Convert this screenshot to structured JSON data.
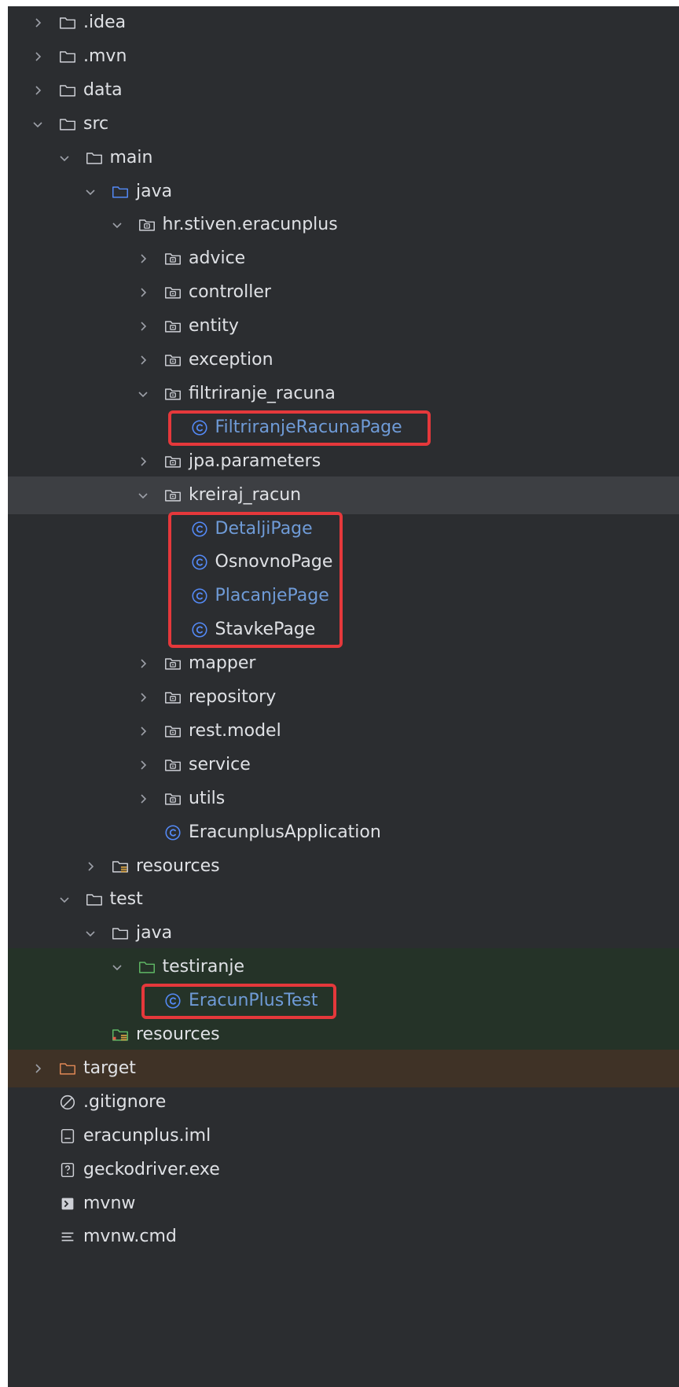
{
  "tree": [
    {
      "label": ".idea",
      "icon": "folder",
      "expand": "collapsed",
      "depth": 0
    },
    {
      "label": ".mvn",
      "icon": "folder",
      "expand": "collapsed",
      "depth": 0
    },
    {
      "label": "data",
      "icon": "folder",
      "expand": "collapsed",
      "depth": 0
    },
    {
      "label": "src",
      "icon": "folder",
      "expand": "expanded",
      "depth": 0
    },
    {
      "label": "main",
      "icon": "folder",
      "expand": "expanded",
      "depth": 1
    },
    {
      "label": "java",
      "icon": "source-folder",
      "expand": "expanded",
      "depth": 2
    },
    {
      "label": "hr.stiven.eracunplus",
      "icon": "package",
      "expand": "expanded",
      "depth": 3
    },
    {
      "label": "advice",
      "icon": "package",
      "expand": "collapsed",
      "depth": 4
    },
    {
      "label": "controller",
      "icon": "package",
      "expand": "collapsed",
      "depth": 4
    },
    {
      "label": "entity",
      "icon": "package",
      "expand": "collapsed",
      "depth": 4
    },
    {
      "label": "exception",
      "icon": "package",
      "expand": "collapsed",
      "depth": 4
    },
    {
      "label": "filtriranje_racuna",
      "icon": "package",
      "expand": "expanded",
      "depth": 4
    },
    {
      "label": "FiltriranjeRacunaPage",
      "icon": "class",
      "expand": "none",
      "depth": 5,
      "modified": true
    },
    {
      "label": "jpa.parameters",
      "icon": "package",
      "expand": "collapsed",
      "depth": 4
    },
    {
      "label": "kreiraj_racun",
      "icon": "package",
      "expand": "expanded",
      "depth": 4,
      "selected": true
    },
    {
      "label": "DetaljiPage",
      "icon": "class",
      "expand": "none",
      "depth": 5,
      "modified": true
    },
    {
      "label": "OsnovnoPage",
      "icon": "class",
      "expand": "none",
      "depth": 5
    },
    {
      "label": "PlacanjePage",
      "icon": "class",
      "expand": "none",
      "depth": 5,
      "modified": true
    },
    {
      "label": "StavkePage",
      "icon": "class",
      "expand": "none",
      "depth": 5
    },
    {
      "label": "mapper",
      "icon": "package",
      "expand": "collapsed",
      "depth": 4
    },
    {
      "label": "repository",
      "icon": "package",
      "expand": "collapsed",
      "depth": 4
    },
    {
      "label": "rest.model",
      "icon": "package",
      "expand": "collapsed",
      "depth": 4
    },
    {
      "label": "service",
      "icon": "package",
      "expand": "collapsed",
      "depth": 4
    },
    {
      "label": "utils",
      "icon": "package",
      "expand": "collapsed",
      "depth": 4
    },
    {
      "label": "EracunplusApplication",
      "icon": "class",
      "expand": "none",
      "depth": 4
    },
    {
      "label": "resources",
      "icon": "resources-folder",
      "expand": "collapsed",
      "depth": 2
    },
    {
      "label": "test",
      "icon": "folder",
      "expand": "expanded",
      "depth": 1
    },
    {
      "label": "java",
      "icon": "folder",
      "expand": "expanded",
      "depth": 2
    },
    {
      "label": "testiranje",
      "icon": "test-folder",
      "expand": "expanded",
      "depth": 3,
      "test": true
    },
    {
      "label": "EracunPlusTest",
      "icon": "class",
      "expand": "none",
      "depth": 4,
      "test": true,
      "modified": true
    },
    {
      "label": "resources",
      "icon": "test-resources-folder",
      "expand": "none",
      "depth": 2,
      "test": true
    },
    {
      "label": "target",
      "icon": "excluded-folder",
      "expand": "collapsed",
      "depth": 0,
      "excluded": true
    },
    {
      "label": ".gitignore",
      "icon": "ignore-file",
      "expand": "none",
      "depth": 0
    },
    {
      "label": "eracunplus.iml",
      "icon": "iml-file",
      "expand": "none",
      "depth": 0
    },
    {
      "label": "geckodriver.exe",
      "icon": "unknown-file",
      "expand": "none",
      "depth": 0
    },
    {
      "label": "mvnw",
      "icon": "shell-file",
      "expand": "none",
      "depth": 0
    },
    {
      "label": "mvnw.cmd",
      "icon": "text-file",
      "expand": "none",
      "depth": 0
    }
  ],
  "highlights": [
    {
      "first": 12,
      "last": 12
    },
    {
      "first": 15,
      "last": 18
    },
    {
      "first": 29,
      "last": 29
    }
  ],
  "colors": {
    "text": "#dfe1e5",
    "modified": "#6f9bd7",
    "chevron": "#9da0a8",
    "icon": "#ced0d6",
    "source": "#548af7",
    "test": "#5fb865",
    "excluded": "#e08855",
    "classIcon": "#548af7",
    "highlight": "#e5383b"
  }
}
